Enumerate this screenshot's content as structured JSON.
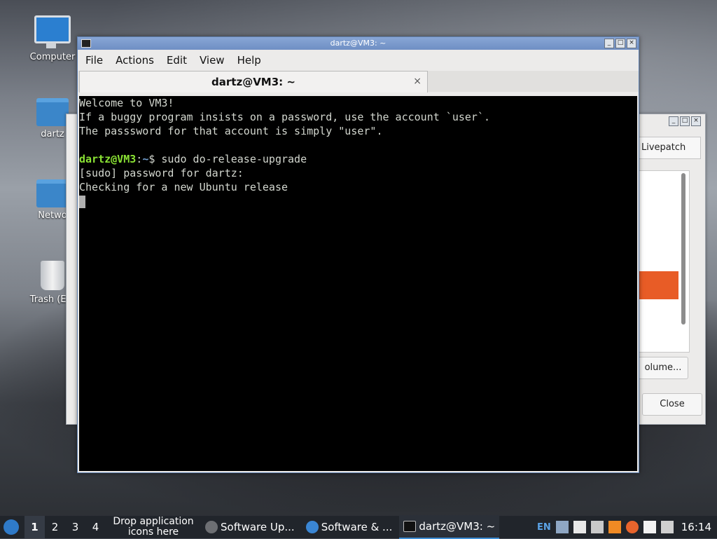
{
  "desktop": {
    "icons": [
      {
        "label": "Computer"
      },
      {
        "label": "dartz"
      },
      {
        "label": "Netwo"
      },
      {
        "label": "Trash (Em"
      }
    ]
  },
  "background_window": {
    "tab_label": "Livepatch",
    "volume_button": "olume...",
    "close_button": "Close",
    "accent_color": "#e85c26"
  },
  "terminal": {
    "window_title": "dartz@VM3: ~",
    "menu": [
      "File",
      "Actions",
      "Edit",
      "View",
      "Help"
    ],
    "tab_title": "dartz@VM3: ~",
    "tab_close": "×",
    "lines": {
      "l1": "Welcome to VM3!",
      "l2": "If a buggy program insists on a password, use the account `user`.",
      "l3": "The passsword for that account is simply \"user\".",
      "prompt_user": "dartz@VM3",
      "prompt_sep": ":",
      "prompt_path": "~",
      "prompt_end": "$ sudo do-release-upgrade",
      "l5": "[sudo] password for dartz:",
      "l6": "Checking for a new Ubuntu release"
    }
  },
  "taskbar": {
    "workspaces": [
      "1",
      "2",
      "3",
      "4"
    ],
    "active_workspace": "1",
    "drop_hint": "Drop application icons here",
    "tasks": [
      {
        "label": "Software Up...",
        "icon": "software-updater-icon"
      },
      {
        "label": "Software & ...",
        "icon": "software-sources-icon"
      },
      {
        "label": "dartz@VM3: ~",
        "icon": "terminal-icon"
      }
    ],
    "language": "EN",
    "clock": "16:14"
  }
}
